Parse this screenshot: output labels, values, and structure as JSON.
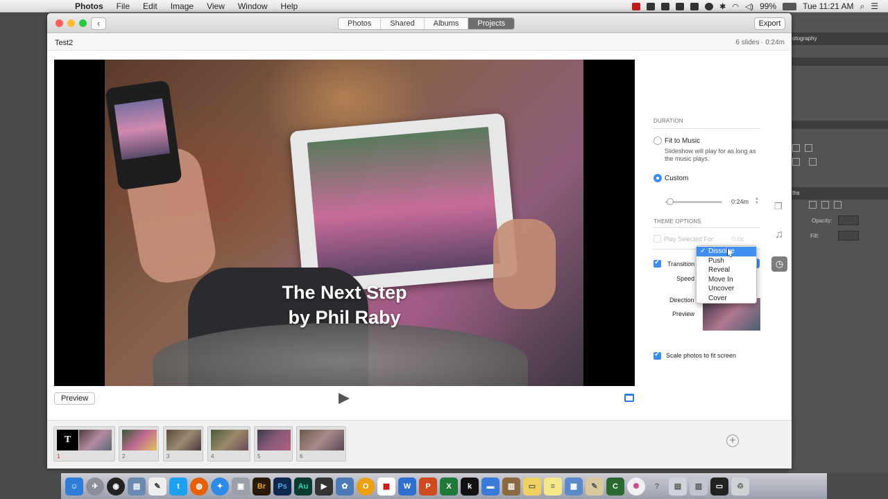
{
  "menubar": {
    "app": "Photos",
    "items": [
      "File",
      "Edit",
      "Image",
      "View",
      "Window",
      "Help"
    ],
    "battery": "99%",
    "clock": "Tue 11:21 AM"
  },
  "toolbar": {
    "tabs": [
      {
        "label": "Photos"
      },
      {
        "label": "Shared"
      },
      {
        "label": "Albums"
      },
      {
        "label": "Projects"
      }
    ],
    "export_label": "Export"
  },
  "project": {
    "name": "Test2",
    "slides_info": "6 slides · 0:24m"
  },
  "slide": {
    "title_line1": "The Next Step",
    "title_line2": "by Phil Raby"
  },
  "player": {
    "preview_label": "Preview"
  },
  "duration": {
    "heading": "DURATION",
    "fit_label": "Fit to Music",
    "fit_desc": "Slideshow will play for as long as the music plays.",
    "custom_label": "Custom",
    "custom_value": "0:24m",
    "custom_fraction": 0.08
  },
  "theme": {
    "heading": "THEME OPTIONS",
    "play_selected_label": "Play Selected For:",
    "play_selected_value": "0.0s"
  },
  "transition": {
    "label": "Transition",
    "speed_label": "Speed",
    "direction_label": "Direction",
    "preview_label": "Preview",
    "options": [
      "Dissolve",
      "Push",
      "Reveal",
      "Move In",
      "Uncover",
      "Cover"
    ],
    "selected": "Dissolve"
  },
  "scale": {
    "label": "Scale photos to fit screen"
  },
  "filmstrip": {
    "slides": [
      {
        "num": "1",
        "text": "T"
      },
      {
        "num": "2"
      },
      {
        "num": "3"
      },
      {
        "num": "4"
      },
      {
        "num": "5"
      },
      {
        "num": "6"
      }
    ]
  },
  "bgapp": {
    "label_workspace": "otography",
    "label_paths": "ths",
    "opacity": "Opacity:",
    "fill": "Fill:"
  },
  "dock": {
    "apps": [
      {
        "label": "Br",
        "color": "#2a1a08"
      },
      {
        "label": "Ps",
        "color": "#0d2a4e"
      },
      {
        "label": "Au",
        "color": "#0a3a30"
      },
      {
        "label": "W",
        "color": "#2f6fd0"
      }
    ],
    "colors": {
      "finder": "#2f7dd8",
      "twitter": "#1da1f2",
      "firefox": "#e66000",
      "safari": "#2d8ae6"
    }
  }
}
